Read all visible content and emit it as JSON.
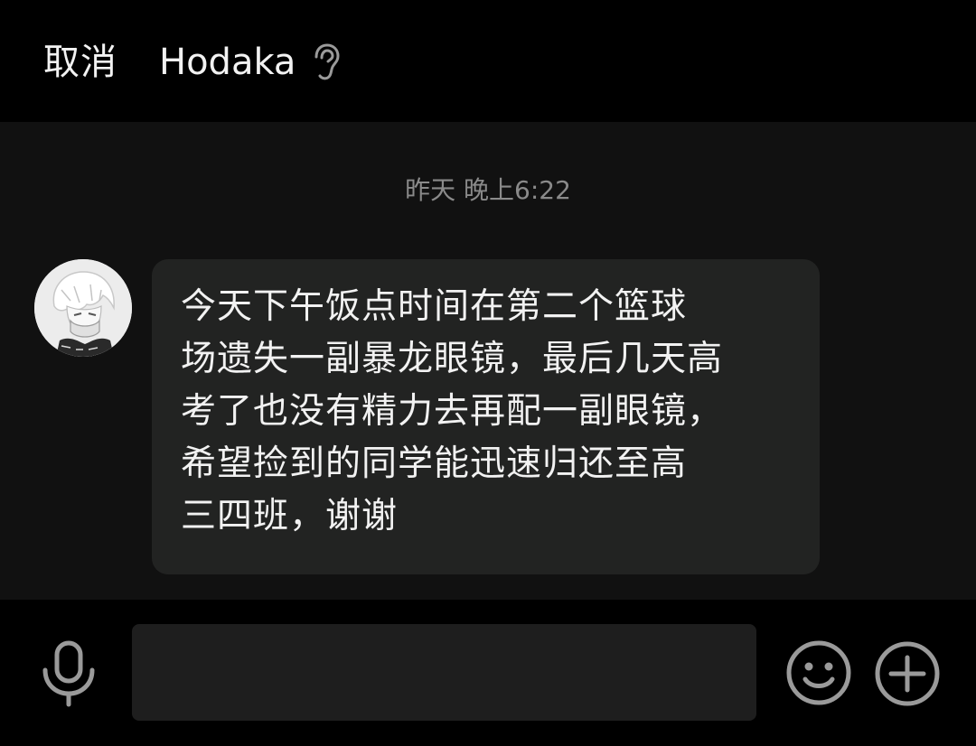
{
  "header": {
    "cancel_label": "取消",
    "contact_name": "Hodaka",
    "mode_icon": "ear-icon"
  },
  "chat": {
    "timestamp": "昨天 晚上6:22",
    "messages": [
      {
        "sender": "Hodaka",
        "avatar_icon": "anime-avatar",
        "lines": [
          "今天下午饭点时间在第二个篮球",
          "场遗失一副暴龙眼镜，最后几天高",
          "考了也没有精力去再配一副眼镜，",
          "希望捡到的同学能迅速归还至高",
          "三四班，谢谢"
        ]
      }
    ]
  },
  "input_bar": {
    "mic_icon": "microphone-icon",
    "input_value": "",
    "input_placeholder": "",
    "emoji_icon": "smiley-icon",
    "plus_icon": "plus-circle-icon"
  },
  "colors": {
    "header_bg": "#000000",
    "chat_bg": "#111111",
    "bubble_bg": "#222322",
    "text": "#f2f2f2",
    "muted": "#8a8a8a"
  }
}
